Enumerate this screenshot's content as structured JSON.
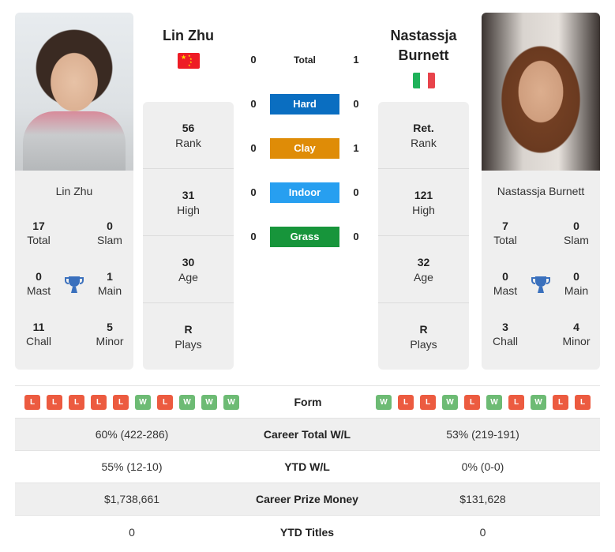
{
  "player1": {
    "name": "Lin Zhu",
    "card_name": "Lin Zhu",
    "flag": "china-flag",
    "photo": "player-photo",
    "stats": [
      {
        "value": "56",
        "label": "Rank"
      },
      {
        "value": "31",
        "label": "High"
      },
      {
        "value": "30",
        "label": "Age"
      },
      {
        "value": "R",
        "label": "Plays"
      }
    ],
    "titles": {
      "total": {
        "value": "17",
        "label": "Total"
      },
      "slam": {
        "value": "0",
        "label": "Slam"
      },
      "mast": {
        "value": "0",
        "label": "Mast"
      },
      "main": {
        "value": "1",
        "label": "Main"
      },
      "chall": {
        "value": "11",
        "label": "Chall"
      },
      "minor": {
        "value": "5",
        "label": "Minor"
      }
    },
    "form": [
      "L",
      "L",
      "L",
      "L",
      "L",
      "W",
      "L",
      "W",
      "W",
      "W"
    ]
  },
  "player2": {
    "name_line1": "Nastassja",
    "name_line2": "Burnett",
    "card_name": "Nastassja Burnett",
    "flag": "italy-flag",
    "photo": "player-photo",
    "stats": [
      {
        "value": "Ret.",
        "label": "Rank"
      },
      {
        "value": "121",
        "label": "High"
      },
      {
        "value": "32",
        "label": "Age"
      },
      {
        "value": "R",
        "label": "Plays"
      }
    ],
    "titles": {
      "total": {
        "value": "7",
        "label": "Total"
      },
      "slam": {
        "value": "0",
        "label": "Slam"
      },
      "mast": {
        "value": "0",
        "label": "Mast"
      },
      "main": {
        "value": "0",
        "label": "Main"
      },
      "chall": {
        "value": "3",
        "label": "Chall"
      },
      "minor": {
        "value": "4",
        "label": "Minor"
      }
    },
    "form": [
      "W",
      "L",
      "L",
      "W",
      "L",
      "W",
      "L",
      "W",
      "L",
      "L"
    ]
  },
  "h2h": [
    {
      "label": "Total",
      "p1": "0",
      "p2": "1",
      "color": ""
    },
    {
      "label": "Hard",
      "p1": "0",
      "p2": "0",
      "color": "#0a6ec1"
    },
    {
      "label": "Clay",
      "p1": "0",
      "p2": "1",
      "color": "#df8c07"
    },
    {
      "label": "Indoor",
      "p1": "0",
      "p2": "0",
      "color": "#279ff0"
    },
    {
      "label": "Grass",
      "p1": "0",
      "p2": "0",
      "color": "#17953b"
    }
  ],
  "form_label": "Form",
  "form_colors": {
    "W": "#6dbb74",
    "L": "#ec5b40"
  },
  "trophy_color": "#3a70bd",
  "comparison": [
    {
      "label": "Career Total W/L",
      "p1": "60% (422-286)",
      "p2": "53% (219-191)"
    },
    {
      "label": "YTD W/L",
      "p1": "55% (12-10)",
      "p2": "0% (0-0)"
    },
    {
      "label": "Career Prize Money",
      "p1": "$1,738,661",
      "p2": "$131,628"
    },
    {
      "label": "YTD Titles",
      "p1": "0",
      "p2": "0"
    }
  ]
}
